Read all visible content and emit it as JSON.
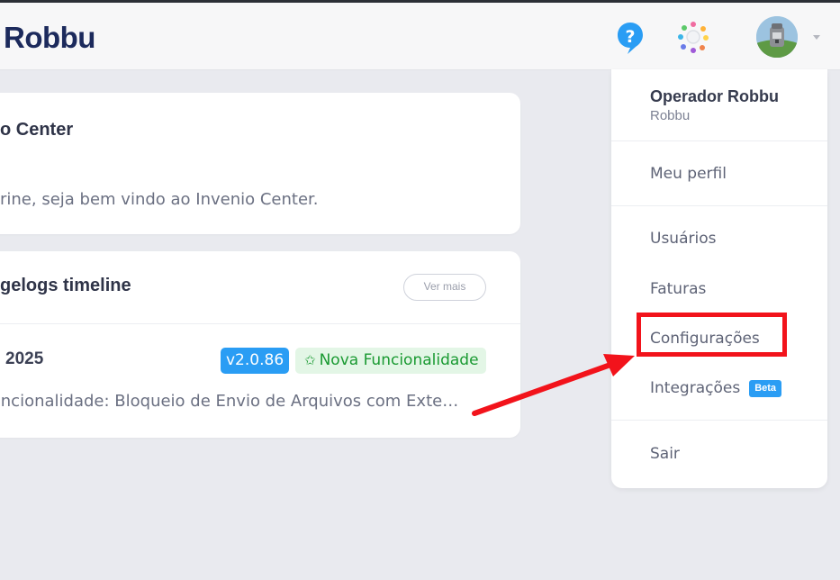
{
  "header": {
    "brand": "Robbu",
    "help_icon": "question-bubble-icon",
    "apps_icon": "apps-dots-icon",
    "avatar": "user-avatar"
  },
  "welcome_card": {
    "title": "o Center",
    "message": "rine, seja bem vindo ao Invenio Center."
  },
  "changelog_card": {
    "title": "gelogs timeline",
    "more_label": "Ver mais",
    "entry": {
      "date": "2025",
      "version": "v2.0.86",
      "tag": "Nova Funcionalidade",
      "tag_icon": "star-icon",
      "description": "Funcionalidade: Bloqueio de Envio de Arquivos com Exte…"
    }
  },
  "user_menu": {
    "name": "Operador Robbu",
    "org": "Robbu",
    "items": [
      {
        "label": "Meu perfil"
      },
      {
        "label": "Usuários"
      },
      {
        "label": "Faturas"
      },
      {
        "label": "Configurações"
      },
      {
        "label": "Integrações",
        "badge": "Beta"
      },
      {
        "label": "Sair"
      }
    ]
  },
  "colors": {
    "accent_blue": "#2a9df4",
    "annotation_red": "#f2131b",
    "success_green": "#1a9a32",
    "brand_navy": "#1c2a5c"
  }
}
